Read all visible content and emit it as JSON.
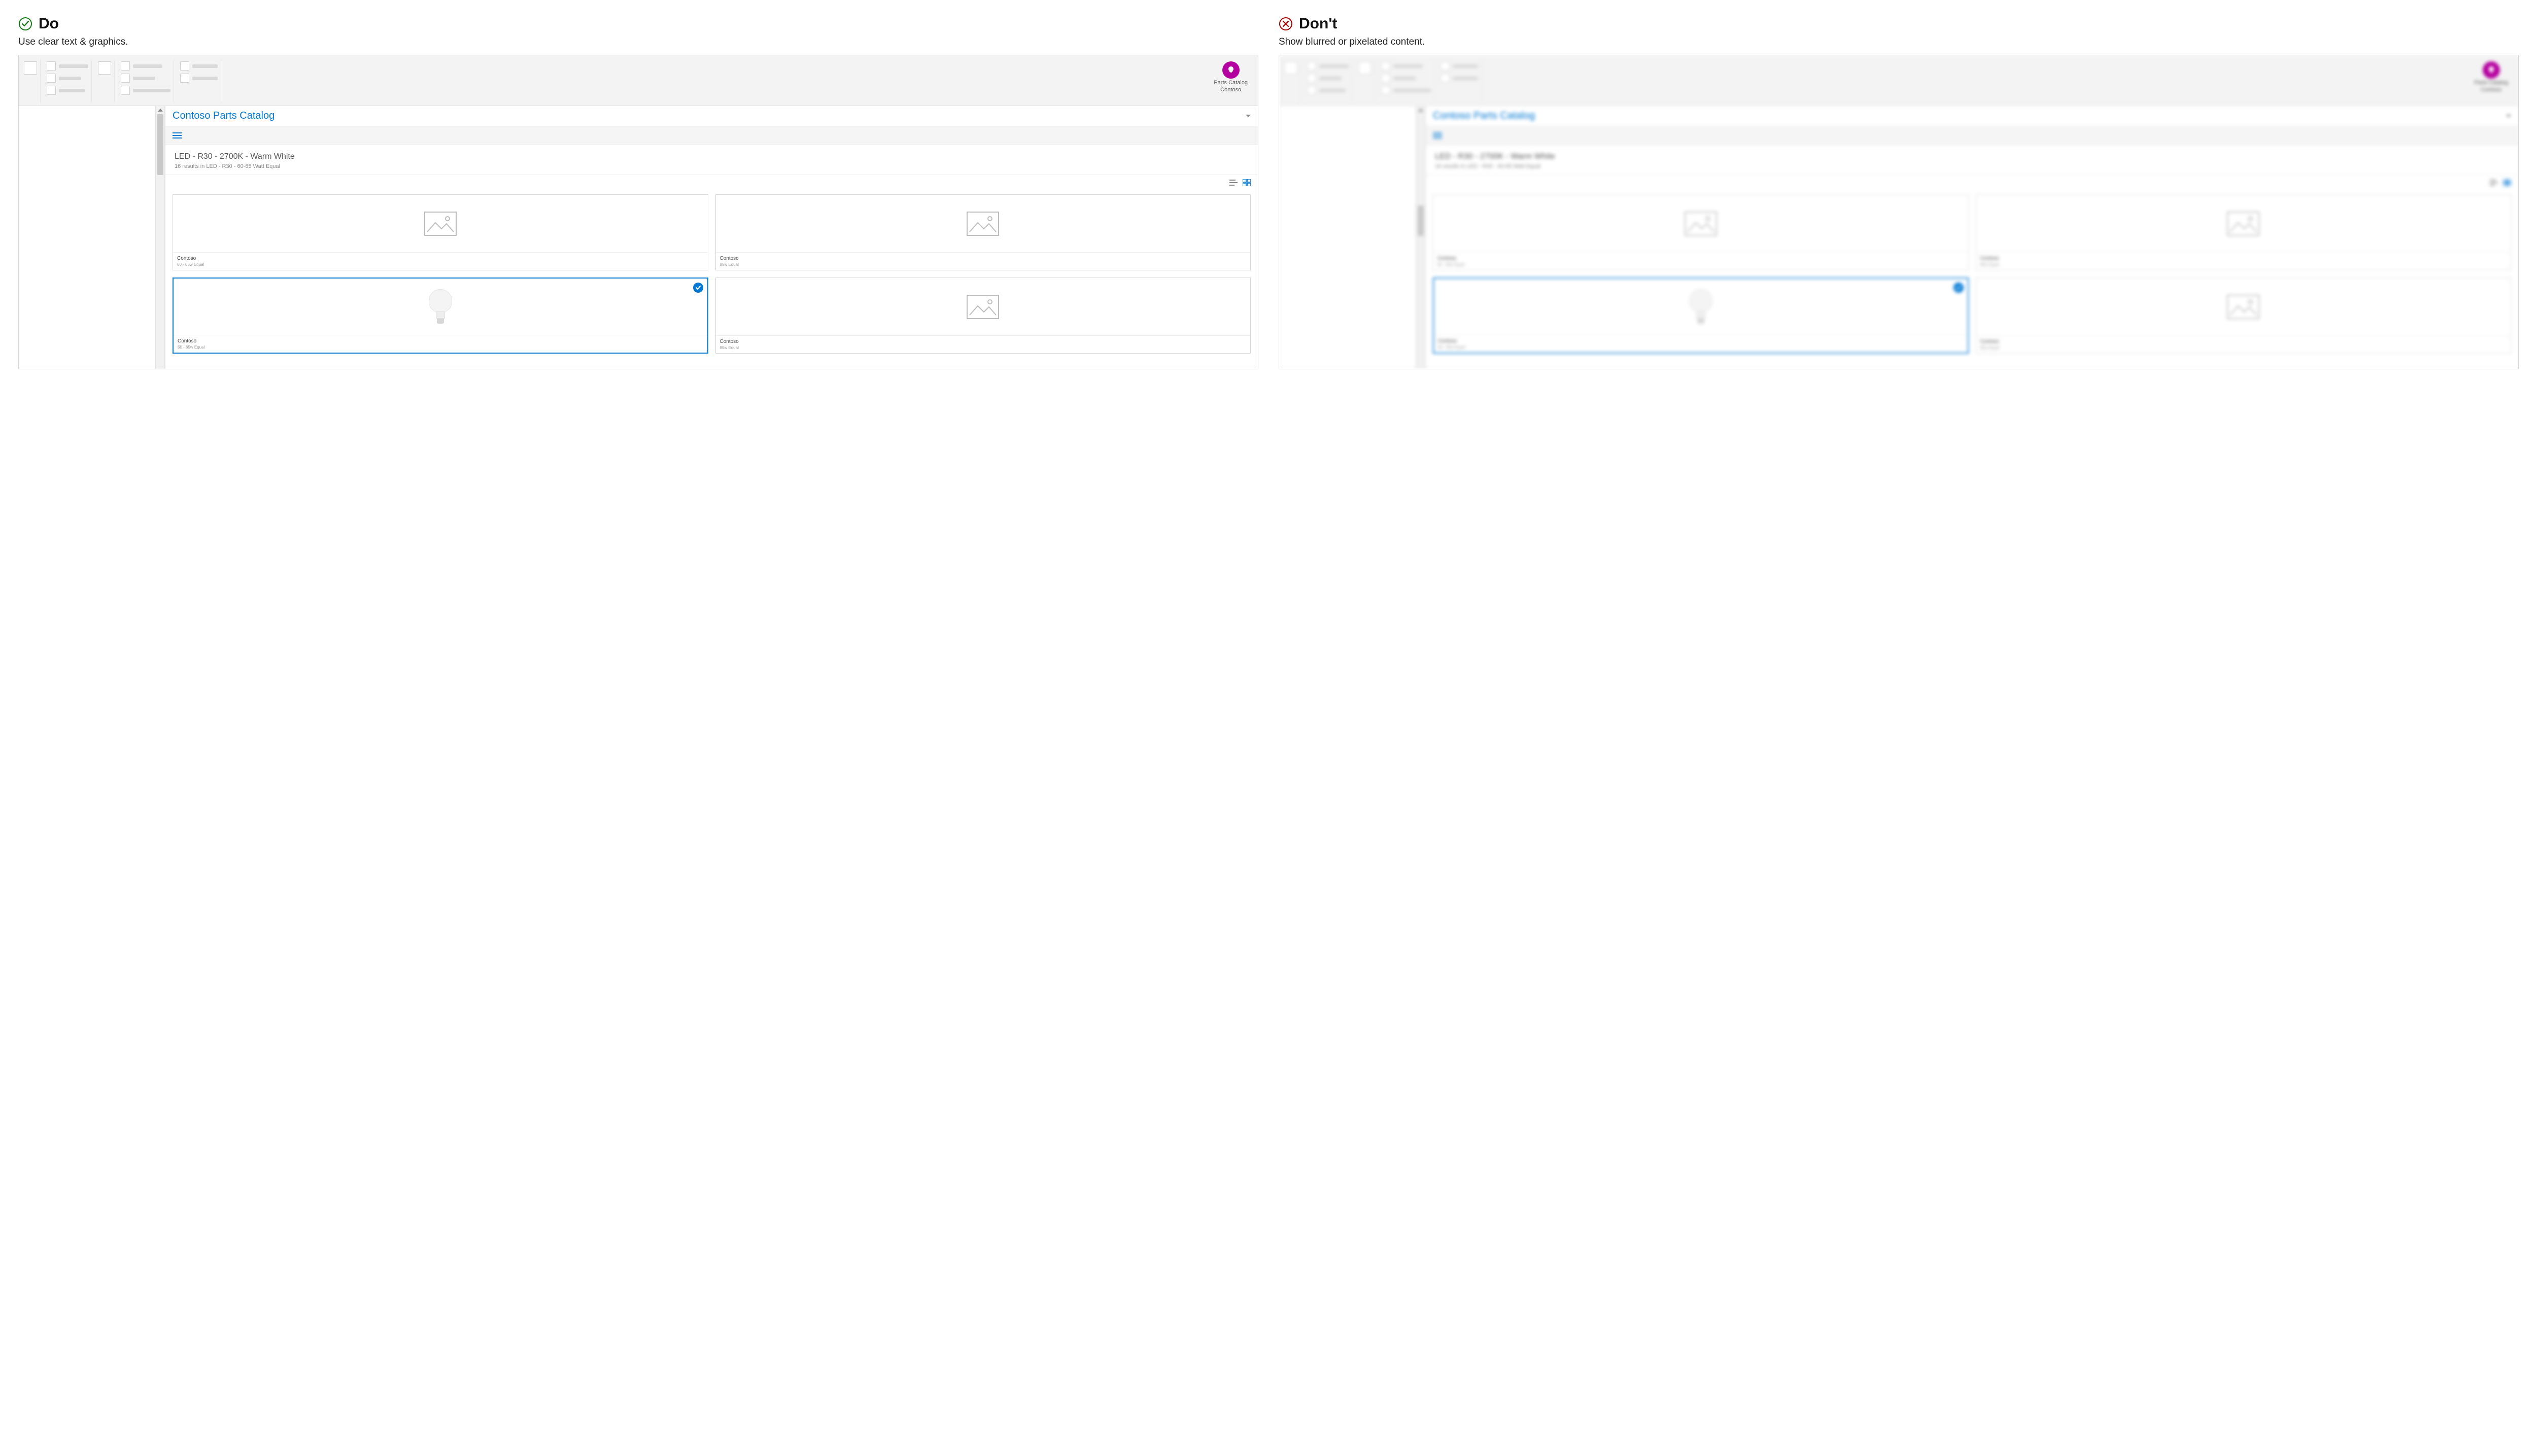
{
  "do": {
    "heading": "Do",
    "subtext": "Use clear text & graphics."
  },
  "dont": {
    "heading": "Don't",
    "subtext": "Show blurred or pixelated content."
  },
  "ribbon": {
    "button_label_line1": "Parts Catalog",
    "button_label_line2": "Contoso"
  },
  "taskpane": {
    "title": "Contoso Parts Catalog",
    "filter_title": "LED - R30 - 2700K - Warm White",
    "filter_sub": "16 results in LED - R30 - 60-65 Watt Equal",
    "cards": [
      {
        "brand": "Contoso",
        "detail": "60 - 65w Equal",
        "selected": false,
        "has_bulb": false
      },
      {
        "brand": "Contoso",
        "detail": "85w Equal",
        "selected": false,
        "has_bulb": false
      },
      {
        "brand": "Contoso",
        "detail": "60 - 65w Equal",
        "selected": true,
        "has_bulb": true
      },
      {
        "brand": "Contoso",
        "detail": "85w Equal",
        "selected": false,
        "has_bulb": false
      }
    ]
  }
}
